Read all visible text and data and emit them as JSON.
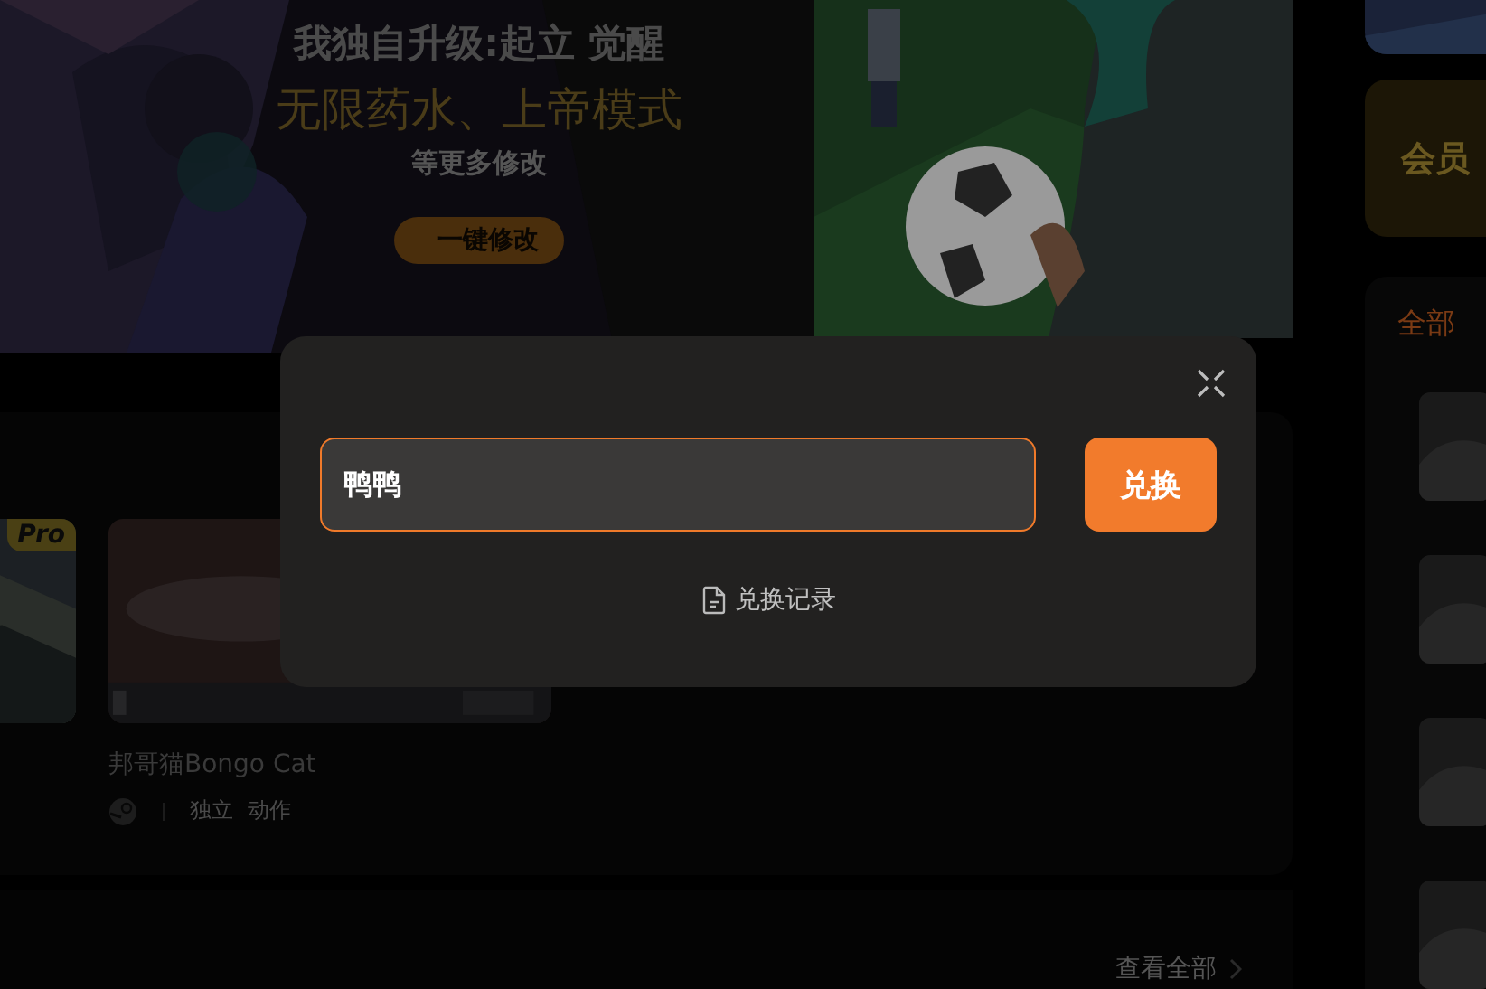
{
  "banner": {
    "title": "我独自升级:起立 觉醒",
    "subtitle": "无限药水、上帝模式",
    "note": "等更多修改",
    "button": "一键修改"
  },
  "sidebar": {
    "vip_label": "会员",
    "filter_tab": "全部"
  },
  "games": [
    {
      "badge": "Pro"
    },
    {
      "title": "邦哥猫Bongo Cat",
      "tags": [
        "独立",
        "动作"
      ]
    }
  ],
  "more_link": "查看全部",
  "dialog": {
    "code_input": {
      "value": "鸭鸭"
    },
    "redeem_button": "兑换",
    "history_link": "兑换记录"
  }
}
